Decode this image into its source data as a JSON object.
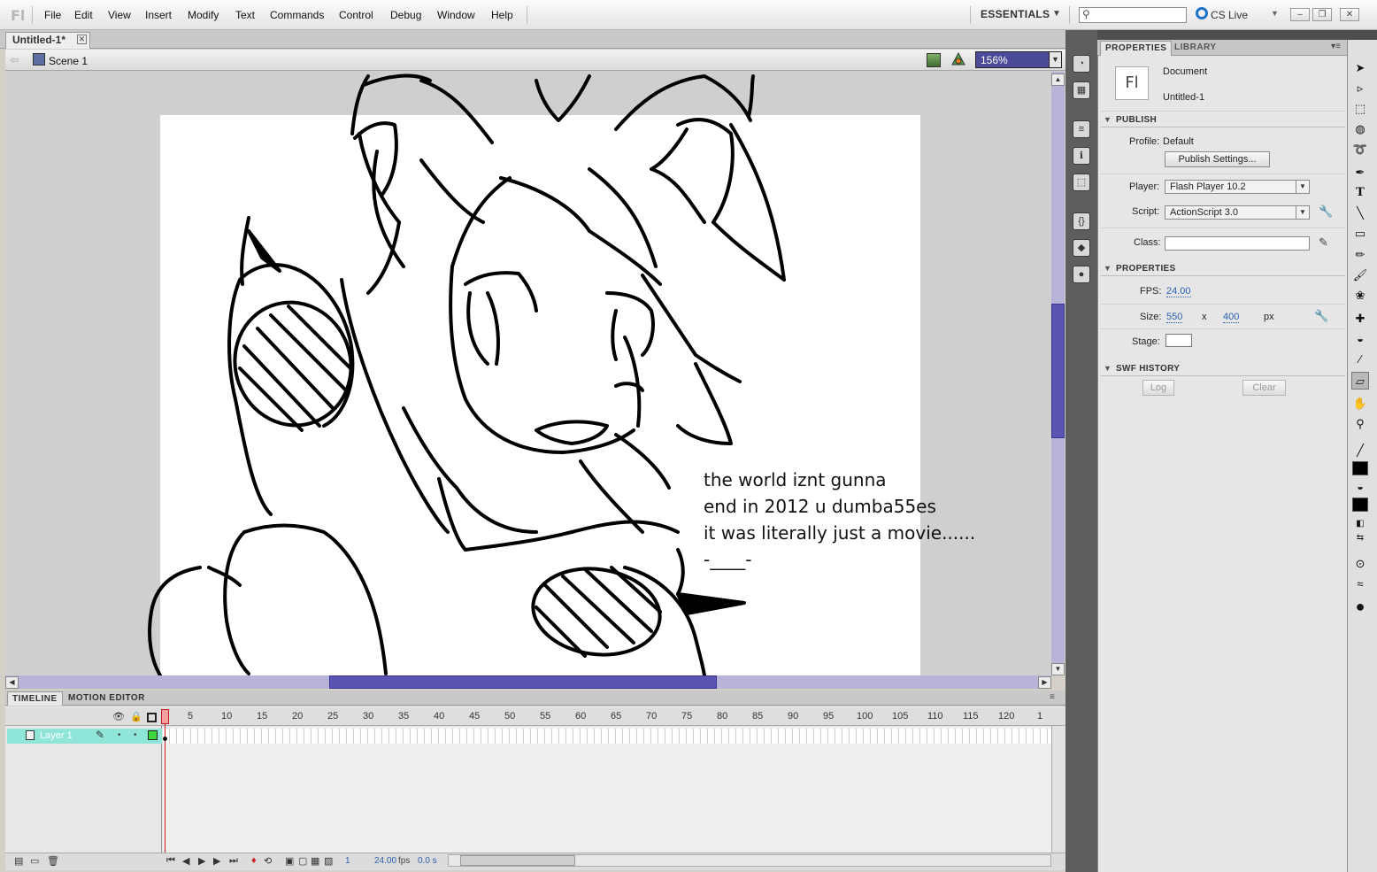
{
  "app": {
    "logo": "Fl"
  },
  "menu": [
    "File",
    "Edit",
    "View",
    "Insert",
    "Modify",
    "Text",
    "Commands",
    "Control",
    "Debug",
    "Window",
    "Help"
  ],
  "workspace": {
    "label": "ESSENTIALS"
  },
  "cslive": {
    "label": "CS Live"
  },
  "document": {
    "tab_title": "Untitled-1*",
    "scene": "Scene 1",
    "zoom": "156%"
  },
  "stage_text": "the world iznt gunna\nend in 2012 u dumba55es\nit was literally just a movie......\n-____-",
  "timeline": {
    "tabs": {
      "timeline": "TIMELINE",
      "motion_editor": "MOTION EDITOR"
    },
    "frame_numbers": [
      "5",
      "10",
      "15",
      "20",
      "25",
      "30",
      "35",
      "40",
      "45",
      "50",
      "55",
      "60",
      "65",
      "70",
      "75",
      "80",
      "85",
      "90",
      "95",
      "100",
      "105",
      "110",
      "115",
      "120",
      "1"
    ],
    "playhead_label": "1",
    "layer_name": "Layer 1",
    "footer": {
      "current_frame": "1",
      "fps": "24.00",
      "fps_unit": "fps",
      "time": "0.0 s"
    }
  },
  "properties": {
    "tabs": {
      "properties": "PROPERTIES",
      "library": "LIBRARY"
    },
    "doc_type": "Document",
    "doc_name": "Untitled-1",
    "publish": {
      "title": "PUBLISH",
      "profile_label": "Profile:",
      "profile_value": "Default",
      "publish_settings": "Publish Settings...",
      "player_label": "Player:",
      "player_value": "Flash Player 10.2",
      "script_label": "Script:",
      "script_value": "ActionScript 3.0",
      "class_label": "Class:",
      "class_value": ""
    },
    "props": {
      "title": "PROPERTIES",
      "fps_label": "FPS:",
      "fps_value": "24.00",
      "size_label": "Size:",
      "width": "550",
      "x": "x",
      "height": "400",
      "unit": "px",
      "stage_label": "Stage:",
      "stage_color": "#ffffff"
    },
    "swf_history": {
      "title": "SWF HISTORY",
      "log": "Log",
      "clear": "Clear"
    }
  },
  "colors": {
    "accent": "#5a55b3",
    "layer_highlight": "#8fe6d8",
    "playhead": "#d41a1a",
    "fill_color": "#000000",
    "stroke_color": "#000000"
  },
  "icons": [
    "search-icon",
    "cslive-icon",
    "scene-icon",
    "edit-scene-icon",
    "edit-symbol-icon",
    "selection-tool-icon",
    "subselection-tool-icon",
    "free-transform-icon",
    "3d-rotation-icon",
    "lasso-icon",
    "pen-icon",
    "text-icon",
    "line-icon",
    "rectangle-icon",
    "pencil-icon",
    "brush-icon",
    "deco-icon",
    "bone-icon",
    "paint-bucket-icon",
    "eyedropper-icon",
    "eraser-icon",
    "hand-icon",
    "zoom-icon"
  ]
}
